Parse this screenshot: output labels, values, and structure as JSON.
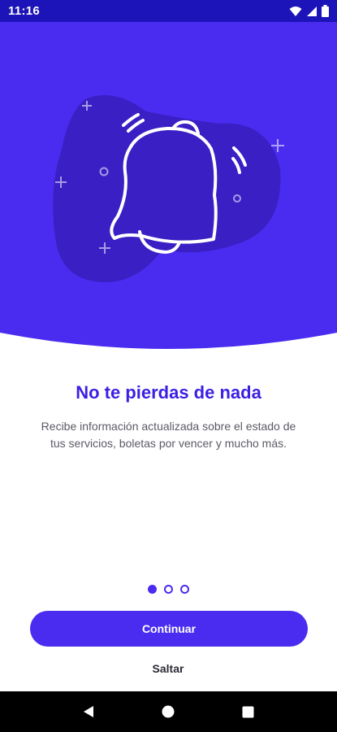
{
  "status_bar": {
    "time": "11:16",
    "icons": [
      "wifi-icon",
      "signal-icon",
      "battery-icon"
    ]
  },
  "hero": {
    "illustration": "bell-icon",
    "colors": {
      "background": "#4a2cf0",
      "blob": "#3a1fc4",
      "line": "#ffffff"
    }
  },
  "onboarding": {
    "title": "No te pierdas de nada",
    "description": "Recibe información actualizada sobre el estado de tus servicios, boletas por vencer y mucho más.",
    "page_count": 3,
    "current_page": 1
  },
  "actions": {
    "continue_label": "Continuar",
    "skip_label": "Saltar"
  },
  "nav_bar": {
    "icons": [
      "back-icon",
      "home-icon",
      "recents-icon"
    ]
  },
  "colors": {
    "accent": "#4a2cf0",
    "title": "#3b1fe3",
    "text": "#5a5a66"
  }
}
